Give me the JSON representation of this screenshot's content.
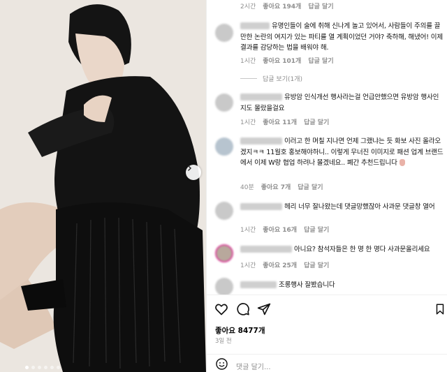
{
  "post": {
    "carousel": {
      "total_slides": 6,
      "active_slide": 1
    }
  },
  "comments": [
    {
      "time": "2시간",
      "likes": "좋아요 194개",
      "reply": "답글 달기"
    },
    {
      "text": "유명인들이 술에 취해 신나게 놀고 있어서, 사람들이 주의를 끌 만한 논란의 여지가 있는 파티를 열 계획이었던 거야? 축하해, 해냈어! 이제 결과를 감당하는 법을 배워야 해.",
      "time": "1시간",
      "likes": "좋아요 101개",
      "reply": "답글 달기",
      "view_replies": "답글 보기(1개)"
    },
    {
      "text": "유방암 인식개선 행사라는걸 언급안했으면 유방암 행사인지도 몰랐을걸요",
      "time": "1시간",
      "likes": "좋아요 11개",
      "reply": "답글 달기"
    },
    {
      "text": "이러고 한 며칠 지나면 언제 그랬냐는 듯 화보 사진 올라오겠지ㅋㅋ 11월호 홍보해야하니.. 이렇게 무너진 이미지로 패션 업계 브랜드에서 이제 W랑 협업 하려나 몰겠네요.. 폐간 추천드립니다",
      "time": "40분",
      "likes": "좋아요 7개",
      "reply": "답글 달기"
    },
    {
      "text": "헤리 너무 잘나왔는데 댓글망했잖아 사과문 댓글창 열어",
      "time": "1시간",
      "likes": "좋아요 16개",
      "reply": "답글 달기"
    },
    {
      "text": "아니요? 참석자들은 한 명 한 명다 사과문올리세요",
      "time": "1시간",
      "likes": "좋아요 25개",
      "reply": "답글 달기"
    },
    {
      "text": "조롱행사 잘봤습니다"
    }
  ],
  "actions": {
    "likes_count": "좋아요 8477개",
    "posted": "3일 전",
    "comment_placeholder": "댓글 달기...",
    "icons": [
      "heart-icon",
      "comment-icon",
      "share-icon",
      "save-icon",
      "emoji-icon"
    ]
  },
  "colors": {
    "muted": "#8e8e8e",
    "story_ring": "#d8489a"
  }
}
